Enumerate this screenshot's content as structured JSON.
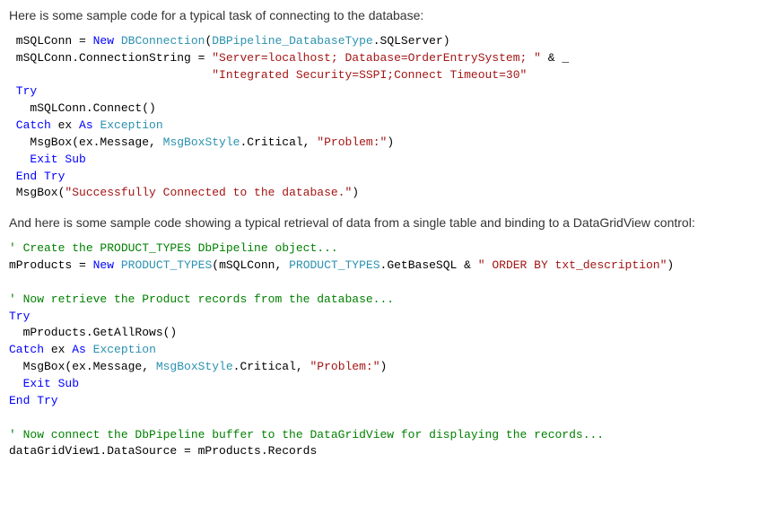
{
  "prose": {
    "p1": "Here is some sample code for a typical task of connecting to the database:",
    "p2": "And here is some sample code showing a typical retrieval of data from a single table and binding to a DataGridView control:"
  },
  "code1": {
    "l1a": " mSQLConn = ",
    "l1_kw_new": "New",
    "l1b": " ",
    "l1_typ_dbc": "DBConnection",
    "l1c": "(",
    "l1_typ_pipe": "DBPipeline_DatabaseType",
    "l1d": ".SQLServer)",
    "l2a": " mSQLConn.ConnectionString = ",
    "l2_str1": "\"Server=localhost; Database=OrderEntrySystem; \"",
    "l2b": " & _",
    "l3pad": "                             ",
    "l3_str": "\"Integrated Security=SSPI;Connect Timeout=30\"",
    "l4_try": " Try",
    "l5": "   mSQLConn.Connect()",
    "l6a": " Catch",
    "l6b": " ex ",
    "l6_as": "As",
    "l6c": " ",
    "l6_exc": "Exception",
    "l7a": "   MsgBox(ex.Message, ",
    "l7_msb": "MsgBoxStyle",
    "l7b": ".Critical, ",
    "l7_str": "\"Problem:\"",
    "l7c": ")",
    "l8": "   Exit Sub",
    "l9": " End Try",
    "l10a": " MsgBox(",
    "l10_str": "\"Successfully Connected to the database.\"",
    "l10b": ")"
  },
  "code2": {
    "c1": "' Create the PRODUCT_TYPES DbPipeline object...",
    "l2a": "mProducts = ",
    "l2_new": "New",
    "l2b": " ",
    "l2_typ": "PRODUCT_TYPES",
    "l2c": "(mSQLConn, ",
    "l2_typ2": "PRODUCT_TYPES",
    "l2d": ".GetBaseSQL & ",
    "l2_str": "\" ORDER BY txt_description\"",
    "l2e": ")",
    "c3": "' Now retrieve the Product records from the database...",
    "l4_try": "Try",
    "l5": "  mProducts.GetAllRows()",
    "l6a": "Catch",
    "l6b": " ex ",
    "l6_as": "As",
    "l6c": " ",
    "l6_exc": "Exception",
    "l7a": "  MsgBox(ex.Message, ",
    "l7_msb": "MsgBoxStyle",
    "l7b": ".Critical, ",
    "l7_str": "\"Problem:\"",
    "l7c": ")",
    "l8": "  Exit Sub",
    "l9": "End Try",
    "c10": "' Now connect the DbPipeline buffer to the DataGridView for displaying the records...",
    "l11": "dataGridView1.DataSource = mProducts.Records"
  }
}
